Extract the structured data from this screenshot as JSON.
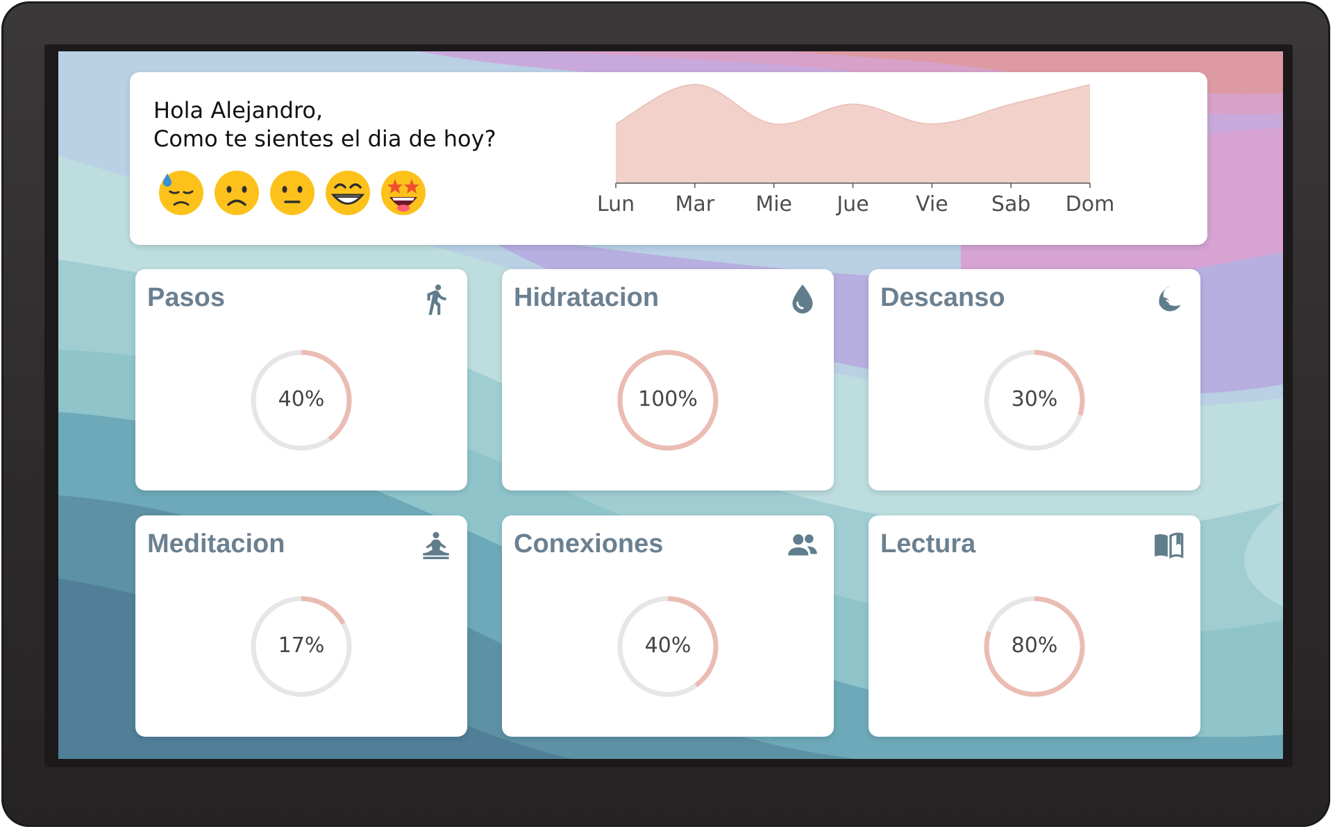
{
  "theme": {
    "accent": "#ebbcb3",
    "track": "#e6e6e6",
    "chart_fill": "#f1d1ca",
    "icon_color": "#607d8b",
    "title_color": "#6b8090"
  },
  "greeting": {
    "line1": "Hola Alejandro,",
    "line2": "Como te sientes el dia de hoy?"
  },
  "moods": [
    {
      "name": "sad-sweat",
      "icon": "downcast-face-with-sweat-icon"
    },
    {
      "name": "frowning",
      "icon": "frowning-face-icon"
    },
    {
      "name": "neutral",
      "icon": "neutral-face-icon"
    },
    {
      "name": "grinning",
      "icon": "grinning-face-icon"
    },
    {
      "name": "star-struck",
      "icon": "star-struck-face-icon"
    }
  ],
  "chart_data": {
    "type": "area",
    "categories": [
      "Lun",
      "Mar",
      "Mie",
      "Jue",
      "Vie",
      "Sab",
      "Dom"
    ],
    "values": [
      3.0,
      5.0,
      3.0,
      4.0,
      3.0,
      4.0,
      5.0
    ],
    "ylim": [
      0,
      5.2
    ],
    "title": "",
    "xlabel": "",
    "ylabel": "",
    "grid": false,
    "legend": "none",
    "color": "#f1d1ca"
  },
  "metrics": [
    {
      "title": "Pasos",
      "percent": 40,
      "label": "40%",
      "icon": "walking-person-icon"
    },
    {
      "title": "Hidratacion",
      "percent": 100,
      "label": "100%",
      "icon": "water-drop-icon"
    },
    {
      "title": "Descanso",
      "percent": 30,
      "label": "30%",
      "icon": "moon-sleep-icon"
    },
    {
      "title": "Meditacion",
      "percent": 17,
      "label": "17%",
      "icon": "meditation-icon"
    },
    {
      "title": "Conexiones",
      "percent": 40,
      "label": "40%",
      "icon": "people-icon"
    },
    {
      "title": "Lectura",
      "percent": 80,
      "label": "80%",
      "icon": "open-book-icon"
    }
  ]
}
